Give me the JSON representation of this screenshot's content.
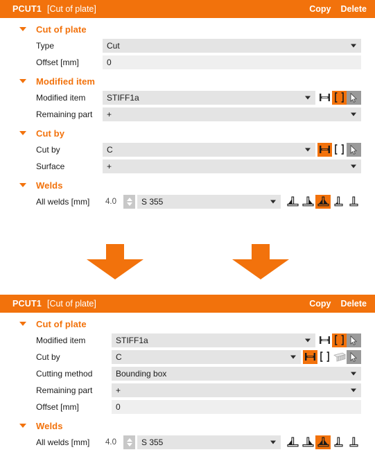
{
  "panels": [
    {
      "header": {
        "id": "PCUT1",
        "subtitle": "[Cut of plate]",
        "copy_label": "Copy",
        "delete_label": "Delete"
      },
      "groups": [
        {
          "title": "Cut of plate",
          "rows": [
            {
              "label": "Type",
              "value": "Cut",
              "kind": "dropdown"
            },
            {
              "label": "Offset [mm]",
              "value": "0",
              "kind": "text"
            }
          ]
        },
        {
          "title": "Modified item",
          "rows": [
            {
              "label": "Modified item",
              "value": "STIFF1a",
              "kind": "dropdown-icons"
            },
            {
              "label": "Remaining part",
              "value": "+",
              "kind": "dropdown"
            }
          ]
        },
        {
          "title": "Cut by",
          "rows": [
            {
              "label": "Cut by",
              "value": "C",
              "kind": "dropdown-icons"
            },
            {
              "label": "Surface",
              "value": "+",
              "kind": "dropdown"
            }
          ]
        },
        {
          "title": "Welds",
          "rows": [
            {
              "label": "All welds [mm]",
              "value": "S 355",
              "spinner_value": "4.0",
              "kind": "weld"
            }
          ]
        }
      ]
    },
    {
      "header": {
        "id": "PCUT1",
        "subtitle": "[Cut of plate]",
        "copy_label": "Copy",
        "delete_label": "Delete"
      },
      "groups": [
        {
          "title": "Cut of plate",
          "rows": [
            {
              "label": "Modified item",
              "value": "STIFF1a",
              "kind": "dropdown-icons"
            },
            {
              "label": "Cut by",
              "value": "C",
              "kind": "dropdown-icons4"
            },
            {
              "label": "Cutting method",
              "value": "Bounding box",
              "kind": "dropdown"
            },
            {
              "label": "Remaining part",
              "value": "+",
              "kind": "dropdown"
            },
            {
              "label": "Offset [mm]",
              "value": "0",
              "kind": "text"
            }
          ]
        },
        {
          "title": "Welds",
          "rows": [
            {
              "label": "All welds [mm]",
              "value": "S 355",
              "spinner_value": "4.0",
              "kind": "weld"
            }
          ]
        }
      ]
    }
  ],
  "icons": {
    "beam": "beam-profile-icon",
    "plate": "plate-icon",
    "plane": "plane-grid-icon",
    "cursor": "pick-cursor-icon",
    "weld_left": "weld-fillet-left-icon",
    "weld_right": "weld-fillet-right-icon",
    "weld_both": "weld-fillet-both-icon",
    "weld_small": "weld-fillet-small-icon",
    "weld_none": "weld-none-icon",
    "arrow": "down-arrow-icon",
    "caret": "collapse-caret-icon",
    "dropdown_caret": "chevron-down-icon"
  },
  "colors": {
    "accent": "#f2720c",
    "field": "#e4e4e4",
    "field_text": "#efefef",
    "dim": "#9a9a9a",
    "spinner": "#c8c8c8"
  },
  "arrows": {
    "count": 2,
    "color": "#f2720c"
  }
}
